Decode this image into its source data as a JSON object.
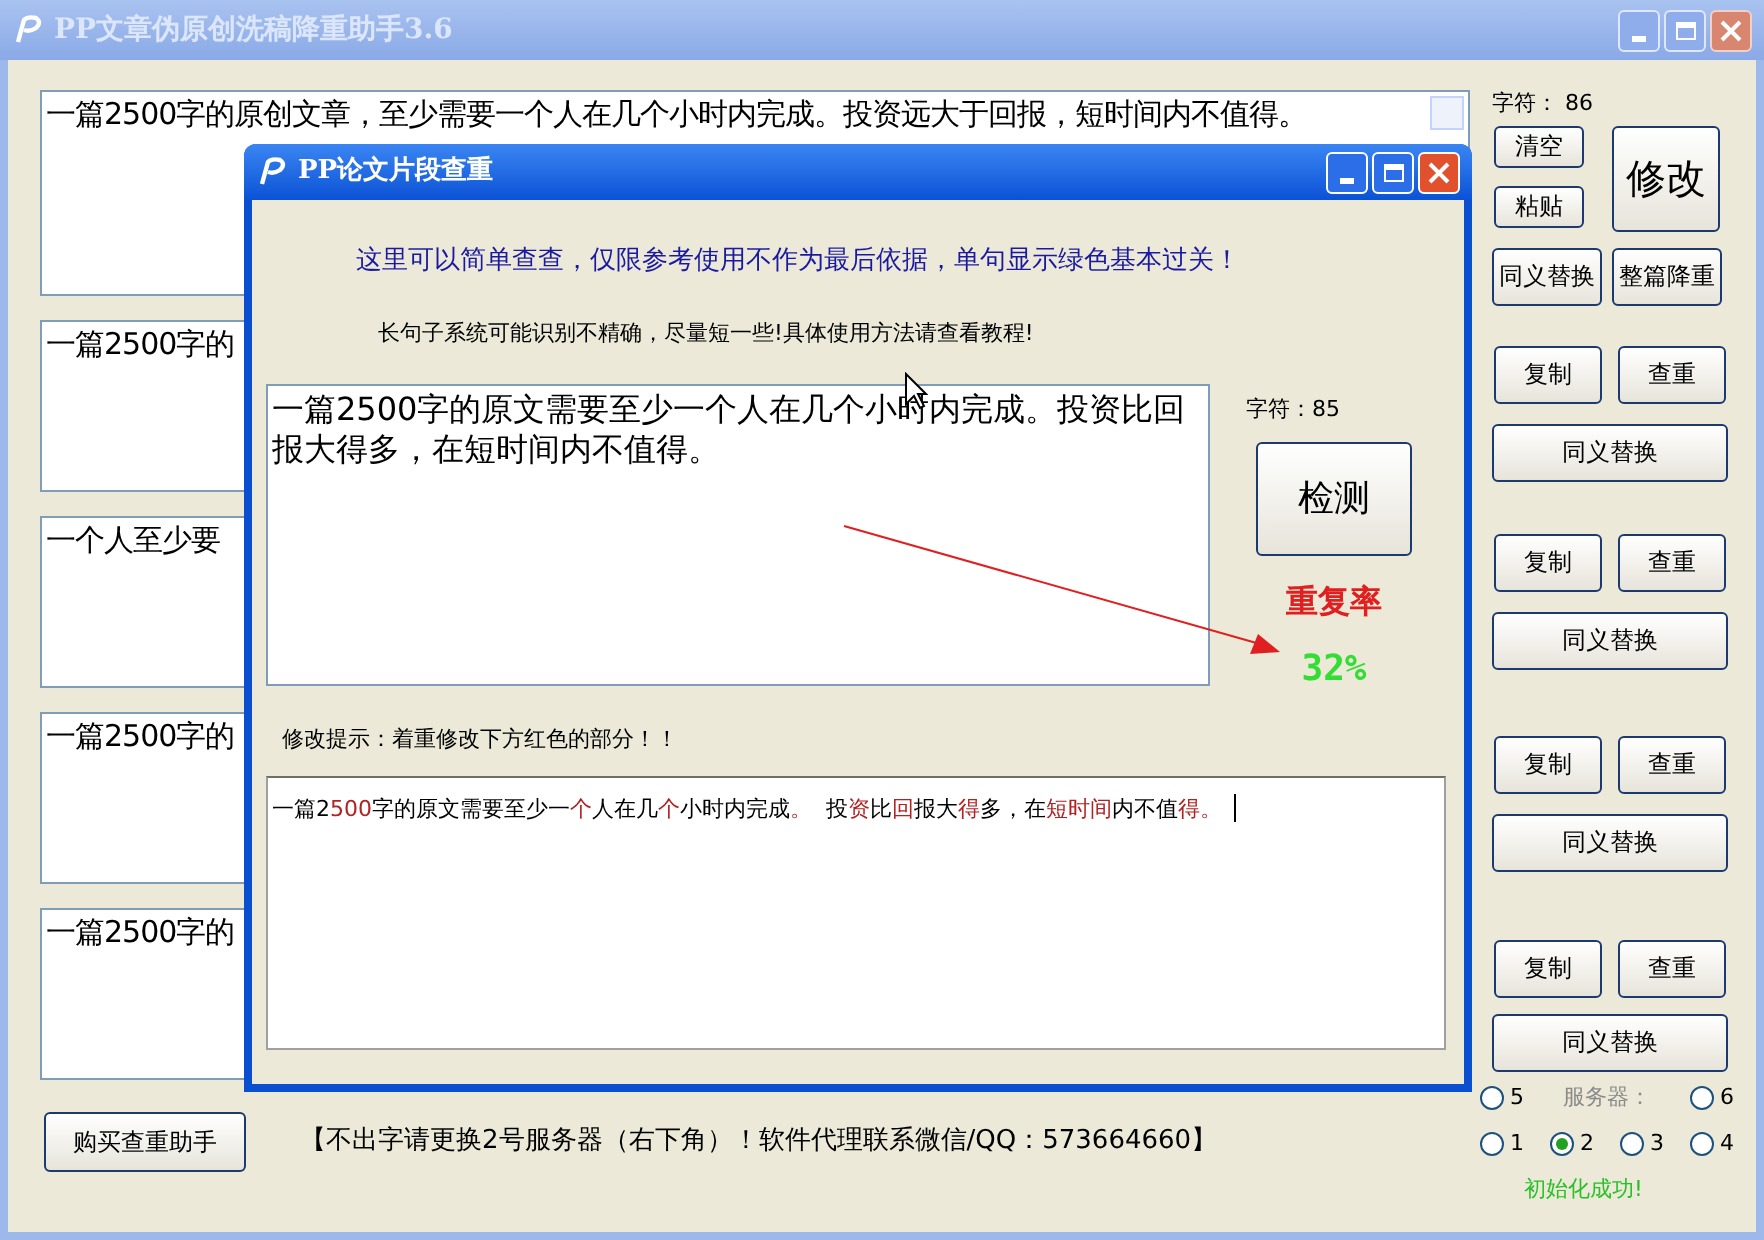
{
  "main_window": {
    "title": "PP文章伪原创洗稿降重助手3.6"
  },
  "articles": [
    "一篇2500字的原创文章，至少需要一个人在几个小时内完成。投资远大于回报，短时间内不值得。",
    "一篇2500字的",
    "一个人至少要",
    "一篇2500字的",
    "一篇2500字的"
  ],
  "char_count": "字符： 86",
  "top_buttons": {
    "clear": "清空",
    "paste": "粘贴",
    "modify": "修改",
    "synonym": "同义替换",
    "rewrite": "整篇降重"
  },
  "groups": [
    {
      "copy": "复制",
      "check": "查重",
      "synonym": "同义替换"
    },
    {
      "copy": "复制",
      "check": "查重",
      "synonym": "同义替换"
    },
    {
      "copy": "复制",
      "check": "查重",
      "synonym": "同义替换"
    },
    {
      "copy": "复制",
      "check": "查重",
      "synonym": "同义替换"
    }
  ],
  "buy_button": "购买查重助手",
  "notice": "【不出字请更换2号服务器（右下角）！软件代理联系微信/QQ：573664660】",
  "servers": {
    "label": "服务器：",
    "options": [
      {
        "label": "5",
        "selected": false
      },
      {
        "label": "6",
        "selected": false
      },
      {
        "label": "1",
        "selected": false
      },
      {
        "label": "2",
        "selected": true
      },
      {
        "label": "3",
        "selected": false
      },
      {
        "label": "4",
        "selected": false
      }
    ]
  },
  "status": "初始化成功!",
  "dialog": {
    "title": "PP论文片段查重",
    "info": "这里可以简单查查，仅限参考使用不作为最后依据，单句显示绿色基本过关！",
    "tip": "长句子系统可能识别不精确，尽量短一些!具体使用方法请查看教程!",
    "input": "一篇2500字的原文需要至少一个人在几个小时内完成。投资比回报大得多，在短时间内不值得。",
    "char_count": "字符：85",
    "check_button": "检测",
    "rate_label": "重复率",
    "rate": "32%",
    "hint": "修改提示：着重修改下方红色的部分！！",
    "result": [
      {
        "text": "一篇2",
        "highlight": false
      },
      {
        "text": "500",
        "highlight": true
      },
      {
        "text": "字的原文需要至少一",
        "highlight": false
      },
      {
        "text": "个",
        "highlight": true
      },
      {
        "text": "人在几",
        "highlight": false
      },
      {
        "text": "个",
        "highlight": true
      },
      {
        "text": "小时内完成",
        "highlight": false
      },
      {
        "text": "。",
        "highlight": true
      },
      {
        "text": "  投",
        "highlight": false
      },
      {
        "text": "资",
        "highlight": true
      },
      {
        "text": "比",
        "highlight": false
      },
      {
        "text": "回",
        "highlight": true
      },
      {
        "text": "报大",
        "highlight": false
      },
      {
        "text": "得",
        "highlight": true
      },
      {
        "text": "多，在",
        "highlight": false
      },
      {
        "text": "短时间",
        "highlight": true
      },
      {
        "text": "内不值",
        "highlight": false
      },
      {
        "text": "得。",
        "highlight": true
      }
    ]
  }
}
